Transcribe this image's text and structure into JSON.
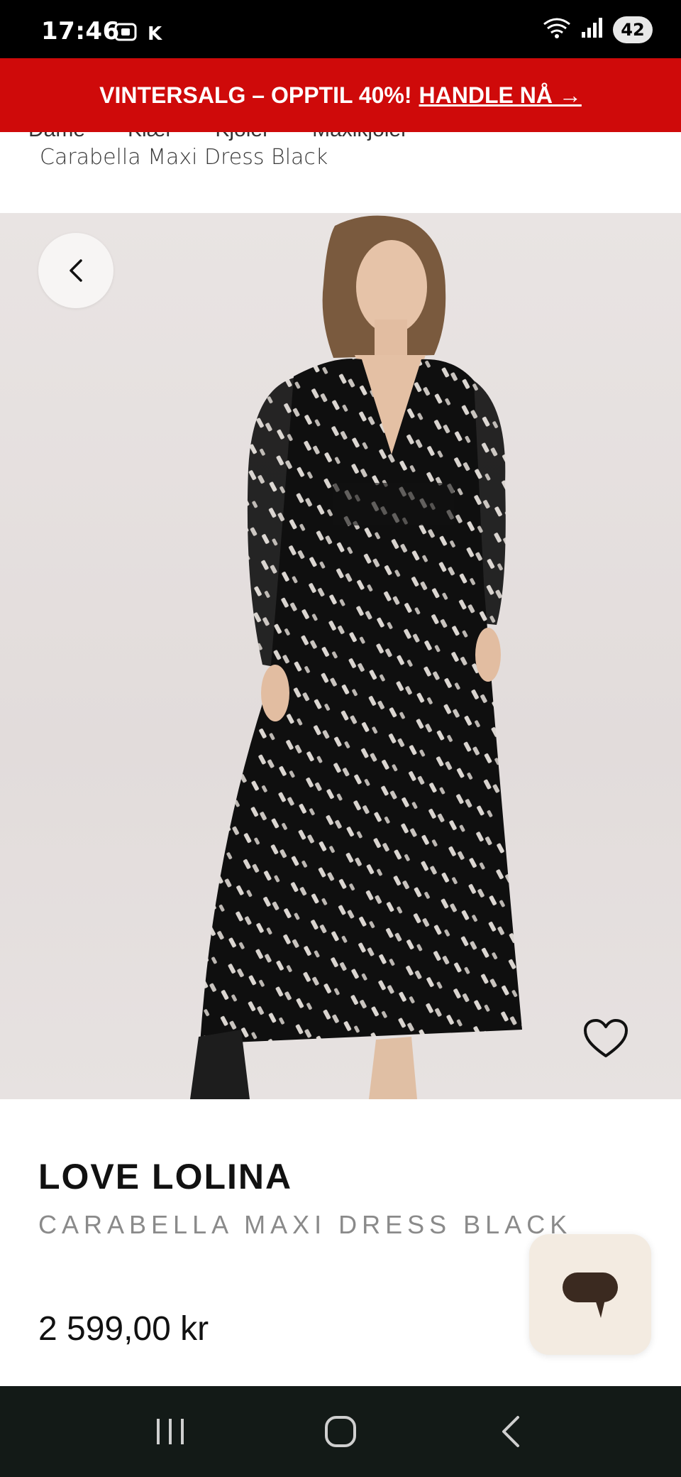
{
  "status_bar": {
    "time": "17:46",
    "carrier_letter": "K",
    "battery": "42"
  },
  "promo": {
    "text": "VINTERSALG – OPPTIL 40%!",
    "link": "HANDLE NÅ →"
  },
  "breadcrumb": {
    "items": [
      "Dame",
      "Klær",
      "Kjoler",
      "Maxikjoler"
    ],
    "current": "Carabella Maxi Dress Black"
  },
  "product": {
    "brand": "LOVE LOLINA",
    "title": "CARABELLA MAXI DRESS BLACK",
    "price": "2 599,00 kr",
    "image_alt": "Carabella Maxi Dress Black"
  },
  "icons": {
    "back": "chevron-left-icon",
    "wishlist": "heart-outline-icon",
    "chat": "chat-bubble-icon"
  },
  "colors": {
    "promo_bg": "#cf0a0a",
    "nav_bg": "#131a17",
    "chat_bg": "#f3ebe1",
    "chat_icon": "#3b2a20"
  }
}
